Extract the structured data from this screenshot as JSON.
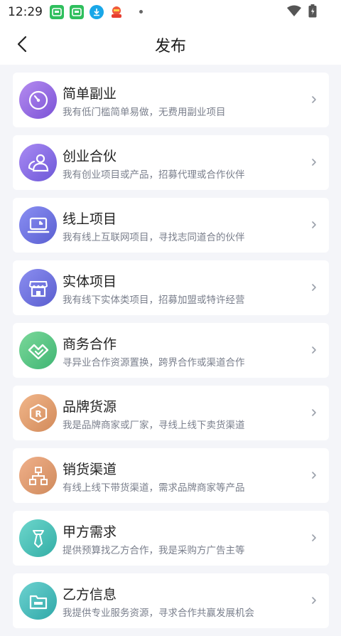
{
  "status_bar": {
    "time": "12:29"
  },
  "header": {
    "title": "发布"
  },
  "items": [
    {
      "title": "简单副业",
      "desc": "我有低门槛简单易做，无费用副业项目",
      "icon": "clock-icon",
      "c1": "#b58cf0",
      "c2": "#7a52d6"
    },
    {
      "title": "创业合伙",
      "desc": "我有创业项目或产品，招募代理或合作伙伴",
      "icon": "partners-icon",
      "c1": "#a98af3",
      "c2": "#6d58d8"
    },
    {
      "title": "线上项目",
      "desc": "我有线上互联网项目，寻找志同道合的伙伴",
      "icon": "laptop-icon",
      "c1": "#8a8ff3",
      "c2": "#5a5fd1"
    },
    {
      "title": "实体项目",
      "desc": "我有线下实体类项目，招募加盟或特许经营",
      "icon": "store-icon",
      "c1": "#8b8ef0",
      "c2": "#5a5ecf"
    },
    {
      "title": "商务合作",
      "desc": "寻异业合作资源置换，跨界合作或渠道合作",
      "icon": "handshake-icon",
      "c1": "#7bd89a",
      "c2": "#3fb573"
    },
    {
      "title": "品牌货源",
      "desc": "我是品牌商家或厂家，寻线上线下卖货渠道",
      "icon": "brand-icon",
      "c1": "#f1b68a",
      "c2": "#d28a5a"
    },
    {
      "title": "销货渠道",
      "desc": "有线上线下带货渠道，需求品牌商家等产品",
      "icon": "channel-icon",
      "c1": "#f0b08a",
      "c2": "#cf8a5c"
    },
    {
      "title": "甲方需求",
      "desc": "提供预算找乙方合作，我是采购方广告主等",
      "icon": "tie-icon",
      "c1": "#6dd6cc",
      "c2": "#33aea6"
    },
    {
      "title": "乙方信息",
      "desc": "我提供专业服务资源，寻求合作共赢发展机会",
      "icon": "folder-icon",
      "c1": "#6dd2d0",
      "c2": "#2fa8a8"
    }
  ]
}
